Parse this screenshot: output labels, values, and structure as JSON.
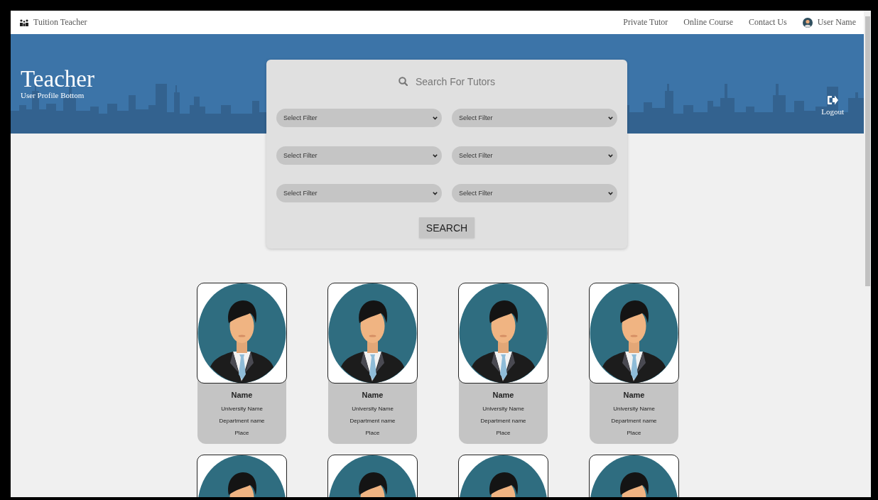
{
  "navbar": {
    "brand": "Tuition Teacher",
    "links": [
      "Private Tutor",
      "Online Course",
      "Contact Us"
    ],
    "user_name": "User Name"
  },
  "banner": {
    "title": "Teacher",
    "subtitle": "User Profile Bottom",
    "logout": "Logout"
  },
  "search": {
    "title": "Search For Tutors",
    "filters": [
      {
        "placeholder": "Select Filter"
      },
      {
        "placeholder": "Select Filter"
      },
      {
        "placeholder": "Select Filter"
      },
      {
        "placeholder": "Select Filter"
      },
      {
        "placeholder": "Select Filter"
      },
      {
        "placeholder": "Select Filter"
      }
    ],
    "button": "SEARCH"
  },
  "tutors": [
    {
      "kind": "full",
      "name": "Name",
      "university": "University Name",
      "department": "Department name",
      "place": "Place"
    },
    {
      "kind": "full",
      "name": "Name",
      "university": "University Name",
      "department": "Department name",
      "place": "Place"
    },
    {
      "kind": "full",
      "name": "Name",
      "university": "University Name",
      "department": "Department name",
      "place": "Place"
    },
    {
      "kind": "full",
      "name": "Name",
      "university": "University Name",
      "department": "Department name",
      "place": "Place"
    },
    {
      "kind": "photo"
    },
    {
      "kind": "photo"
    },
    {
      "kind": "photo"
    },
    {
      "kind": "photo"
    }
  ]
}
